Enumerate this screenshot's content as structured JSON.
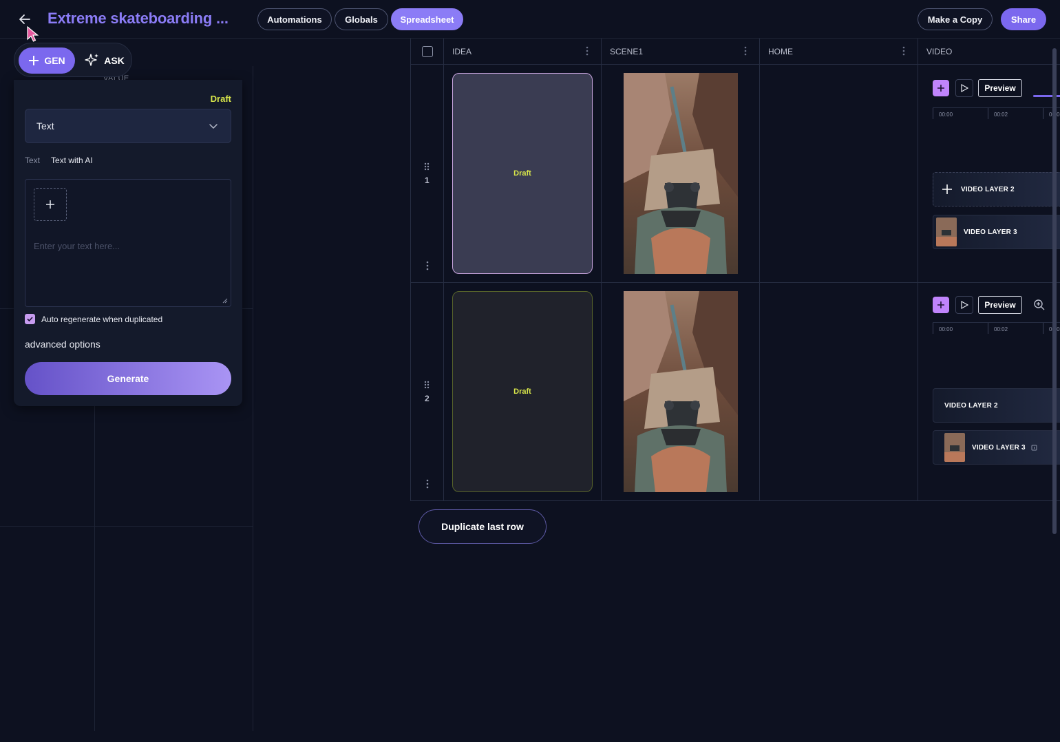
{
  "header": {
    "title": "Extreme skateboarding ...",
    "tabs": [
      "Automations",
      "Globals",
      "Spreadsheet"
    ],
    "active_tab": "Spreadsheet",
    "make_copy": "Make a Copy",
    "share": "Share"
  },
  "mode_toggle": {
    "gen": "GEN",
    "ask": "ASK",
    "active": "GEN"
  },
  "left_table": {
    "value_header": "VALUE"
  },
  "panel": {
    "status": "Draft",
    "type_select": "Text",
    "sub_tabs": [
      "Text",
      "Text with AI"
    ],
    "active_sub_tab": "Text with AI",
    "text_placeholder": "Enter your text here...",
    "auto_regenerate_label": "Auto regenerate when duplicated",
    "auto_regenerate_checked": true,
    "advanced_options": "advanced options",
    "generate": "Generate"
  },
  "sheet": {
    "columns": [
      "IDEA",
      "SCENE1",
      "HOME",
      "VIDEO"
    ],
    "rows": [
      {
        "number": "1",
        "idea": "Draft",
        "video": {
          "preview": "Preview",
          "ticks": [
            "00:00",
            "00:02",
            "00:0"
          ],
          "layers": [
            {
              "name": "VIDEO LAYER 2",
              "has_thumb": false,
              "add_icon": true
            },
            {
              "name": "VIDEO LAYER 3",
              "has_thumb": true
            }
          ]
        }
      },
      {
        "number": "2",
        "idea": "Draft",
        "video": {
          "preview": "Preview",
          "ticks": [
            "00:00",
            "00:02",
            "00:0"
          ],
          "layers": [
            {
              "name": "VIDEO LAYER 2",
              "has_thumb": false
            },
            {
              "name": "VIDEO LAYER 3",
              "has_thumb": true
            }
          ]
        }
      }
    ]
  },
  "duplicate_last_row": "Duplicate last row",
  "colors": {
    "background": "#0d1120",
    "accent": "#7b68ee",
    "title": "#8b7cf6",
    "draft": "#d7e54a",
    "checkbox": "#c79cf0"
  }
}
